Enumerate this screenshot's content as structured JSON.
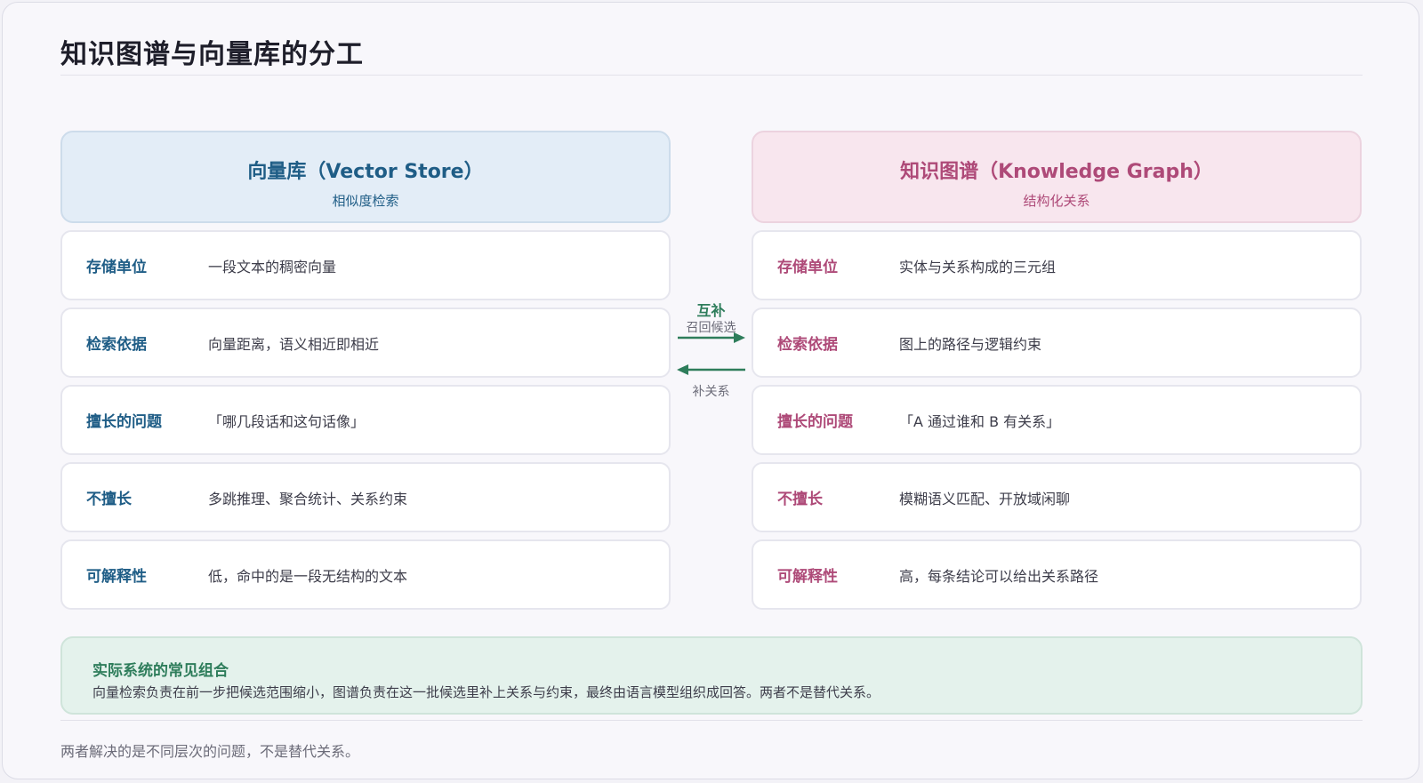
{
  "title": "知识图谱与向量库的分工",
  "left": {
    "title": "向量库（Vector Store）",
    "subtitle": "相似度检索",
    "rows": [
      {
        "label": "存储单位",
        "value": "一段文本的稠密向量"
      },
      {
        "label": "检索依据",
        "value": "向量距离，语义相近即相近"
      },
      {
        "label": "擅长的问题",
        "value": "「哪几段话和这句话像」"
      },
      {
        "label": "不擅长",
        "value": "多跳推理、聚合统计、关系约束"
      },
      {
        "label": "可解释性",
        "value": "低，命中的是一段无结构的文本"
      }
    ]
  },
  "right": {
    "title": "知识图谱（Knowledge Graph）",
    "subtitle": "结构化关系",
    "rows": [
      {
        "label": "存储单位",
        "value": "实体与关系构成的三元组"
      },
      {
        "label": "检索依据",
        "value": "图上的路径与逻辑约束"
      },
      {
        "label": "擅长的问题",
        "value": "「A 通过谁和 B 有关系」"
      },
      {
        "label": "不擅长",
        "value": "模糊语义匹配、开放域闲聊"
      },
      {
        "label": "可解释性",
        "value": "高，每条结论可以给出关系路径"
      }
    ]
  },
  "middle": {
    "title": "互补",
    "to_right": "召回候选",
    "to_left": "补关系"
  },
  "summary": {
    "title": "实际系统的常见组合",
    "text": "向量检索负责在前一步把候选范围缩小，图谱负责在这一批候选里补上关系与约束，最终由语言模型组织成回答。两者不是替代关系。"
  },
  "footnote": "两者解决的是不同层次的问题，不是替代关系。",
  "colors": {
    "vector_accent": "#1f5d86",
    "graph_accent": "#ae4a78",
    "complement_accent": "#2e7d5b"
  }
}
